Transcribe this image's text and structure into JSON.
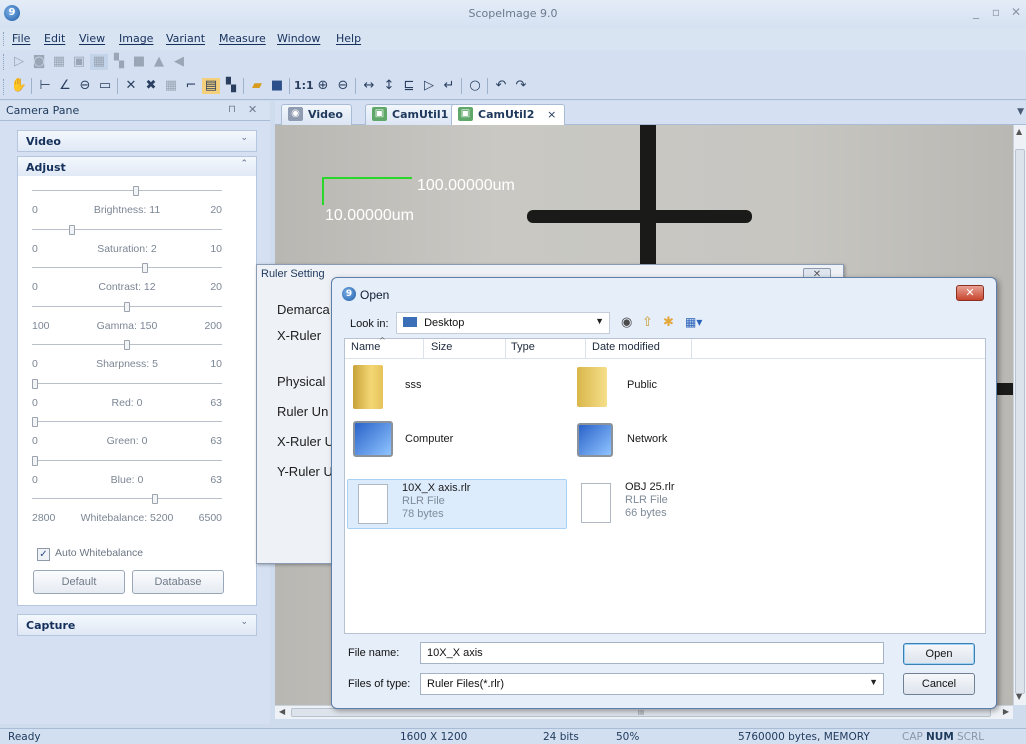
{
  "app": {
    "title": "ScopeImage 9.0",
    "icon_letter": "9"
  },
  "menu": [
    "File",
    "Edit",
    "View",
    "Image",
    "Variant",
    "Measure",
    "Window",
    "Help"
  ],
  "camera_pane": {
    "title": "Camera Pane",
    "sections": {
      "video": "Video",
      "adjust": "Adjust",
      "capture": "Capture"
    },
    "sliders": [
      {
        "min": "0",
        "label": "Brightness: 11",
        "max": "20",
        "value": 0.55
      },
      {
        "min": "0",
        "label": "Saturation: 2",
        "max": "10",
        "value": 0.2
      },
      {
        "min": "0",
        "label": "Contrast: 12",
        "max": "20",
        "value": 0.6
      },
      {
        "min": "100",
        "label": "Gamma: 150",
        "max": "200",
        "value": 0.5
      },
      {
        "min": "0",
        "label": "Sharpness: 5",
        "max": "10",
        "value": 0.5
      },
      {
        "min": "0",
        "label": "Red: 0",
        "max": "63",
        "value": 0.0
      },
      {
        "min": "0",
        "label": "Green: 0",
        "max": "63",
        "value": 0.0
      },
      {
        "min": "0",
        "label": "Blue: 0",
        "max": "63",
        "value": 0.0
      },
      {
        "min": "2800",
        "label": "Whitebalance: 5200",
        "max": "6500",
        "value": 0.65
      }
    ],
    "auto_whitebalance": "Auto Whitebalance",
    "default_btn": "Default",
    "database_btn": "Database"
  },
  "tabs": [
    "Video",
    "CamUtil1",
    "CamUtil2"
  ],
  "tab_close": "×",
  "overlay": {
    "x_label": "100.00000um",
    "y_label": "10.00000um"
  },
  "ruler_dialog": {
    "title": "Ruler Setting",
    "labels": [
      "Demarca",
      "X-Ruler",
      "Physical",
      "Ruler Un",
      "X-Ruler U",
      "Y-Ruler U"
    ]
  },
  "open_dialog": {
    "title": "Open",
    "look_in_label": "Look in:",
    "look_in_value": "Desktop",
    "columns": [
      "Name",
      "Size",
      "Type",
      "Date modified"
    ],
    "files": [
      {
        "name": "sss",
        "type": "folder"
      },
      {
        "name": "Public",
        "type": "folder"
      },
      {
        "name": "Computer",
        "type": "system"
      },
      {
        "name": "Network",
        "type": "system"
      },
      {
        "name": "10X_X axis.rlr",
        "kind": "RLR File",
        "size": "78 bytes",
        "selected": true
      },
      {
        "name": "OBJ 25.rlr",
        "kind": "RLR File",
        "size": "66 bytes",
        "selected": false
      }
    ],
    "file_name_label": "File name:",
    "file_name_value": "10X_X axis",
    "files_of_type_label": "Files of type:",
    "files_of_type_value": "Ruler Files(*.rlr)",
    "open_btn": "Open",
    "cancel_btn": "Cancel"
  },
  "status": {
    "ready": "Ready",
    "resolution": "1600 X 1200",
    "bits": "24 bits",
    "zoom": "50%",
    "memory": "5760000 bytes, MEMORY",
    "cap": "CAP",
    "num": "NUM",
    "scrl": "SCRL"
  },
  "hscroll_grip": "III"
}
